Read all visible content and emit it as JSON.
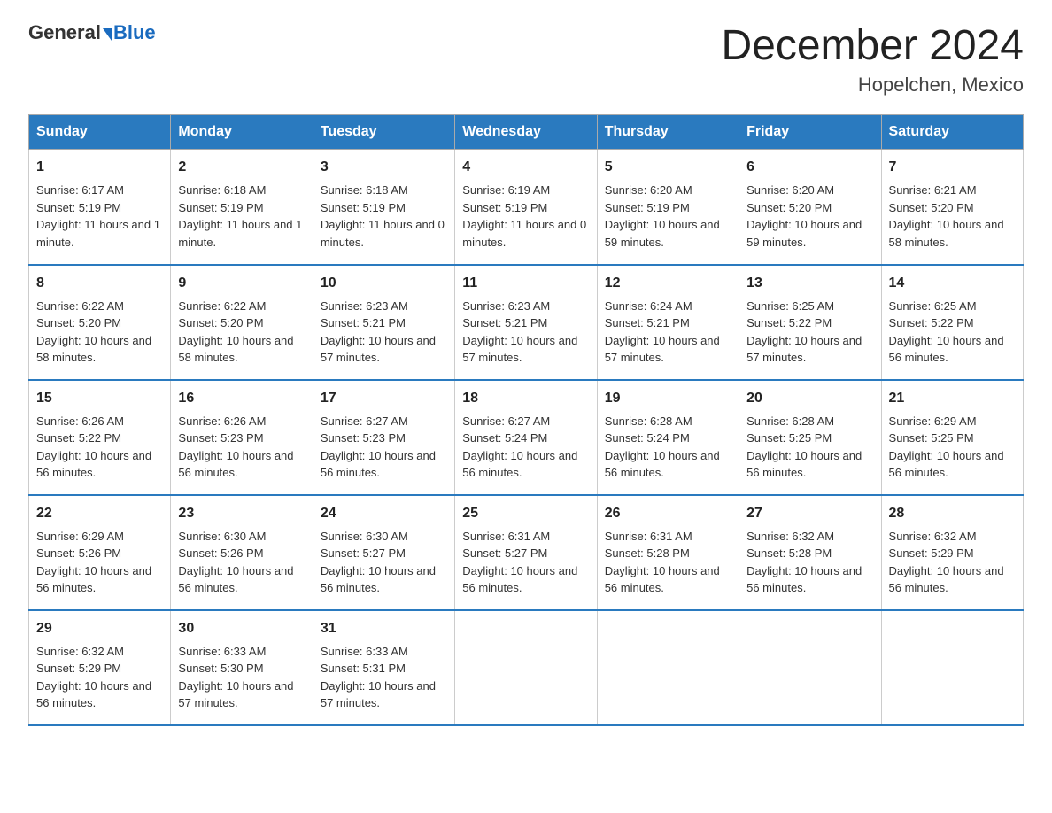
{
  "header": {
    "logo_general": "General",
    "logo_blue": "Blue",
    "main_title": "December 2024",
    "subtitle": "Hopelchen, Mexico"
  },
  "days_of_week": [
    "Sunday",
    "Monday",
    "Tuesday",
    "Wednesday",
    "Thursday",
    "Friday",
    "Saturday"
  ],
  "weeks": [
    [
      {
        "day": 1,
        "sunrise": "6:17 AM",
        "sunset": "5:19 PM",
        "daylight": "11 hours and 1 minute."
      },
      {
        "day": 2,
        "sunrise": "6:18 AM",
        "sunset": "5:19 PM",
        "daylight": "11 hours and 1 minute."
      },
      {
        "day": 3,
        "sunrise": "6:18 AM",
        "sunset": "5:19 PM",
        "daylight": "11 hours and 0 minutes."
      },
      {
        "day": 4,
        "sunrise": "6:19 AM",
        "sunset": "5:19 PM",
        "daylight": "11 hours and 0 minutes."
      },
      {
        "day": 5,
        "sunrise": "6:20 AM",
        "sunset": "5:19 PM",
        "daylight": "10 hours and 59 minutes."
      },
      {
        "day": 6,
        "sunrise": "6:20 AM",
        "sunset": "5:20 PM",
        "daylight": "10 hours and 59 minutes."
      },
      {
        "day": 7,
        "sunrise": "6:21 AM",
        "sunset": "5:20 PM",
        "daylight": "10 hours and 58 minutes."
      }
    ],
    [
      {
        "day": 8,
        "sunrise": "6:22 AM",
        "sunset": "5:20 PM",
        "daylight": "10 hours and 58 minutes."
      },
      {
        "day": 9,
        "sunrise": "6:22 AM",
        "sunset": "5:20 PM",
        "daylight": "10 hours and 58 minutes."
      },
      {
        "day": 10,
        "sunrise": "6:23 AM",
        "sunset": "5:21 PM",
        "daylight": "10 hours and 57 minutes."
      },
      {
        "day": 11,
        "sunrise": "6:23 AM",
        "sunset": "5:21 PM",
        "daylight": "10 hours and 57 minutes."
      },
      {
        "day": 12,
        "sunrise": "6:24 AM",
        "sunset": "5:21 PM",
        "daylight": "10 hours and 57 minutes."
      },
      {
        "day": 13,
        "sunrise": "6:25 AM",
        "sunset": "5:22 PM",
        "daylight": "10 hours and 57 minutes."
      },
      {
        "day": 14,
        "sunrise": "6:25 AM",
        "sunset": "5:22 PM",
        "daylight": "10 hours and 56 minutes."
      }
    ],
    [
      {
        "day": 15,
        "sunrise": "6:26 AM",
        "sunset": "5:22 PM",
        "daylight": "10 hours and 56 minutes."
      },
      {
        "day": 16,
        "sunrise": "6:26 AM",
        "sunset": "5:23 PM",
        "daylight": "10 hours and 56 minutes."
      },
      {
        "day": 17,
        "sunrise": "6:27 AM",
        "sunset": "5:23 PM",
        "daylight": "10 hours and 56 minutes."
      },
      {
        "day": 18,
        "sunrise": "6:27 AM",
        "sunset": "5:24 PM",
        "daylight": "10 hours and 56 minutes."
      },
      {
        "day": 19,
        "sunrise": "6:28 AM",
        "sunset": "5:24 PM",
        "daylight": "10 hours and 56 minutes."
      },
      {
        "day": 20,
        "sunrise": "6:28 AM",
        "sunset": "5:25 PM",
        "daylight": "10 hours and 56 minutes."
      },
      {
        "day": 21,
        "sunrise": "6:29 AM",
        "sunset": "5:25 PM",
        "daylight": "10 hours and 56 minutes."
      }
    ],
    [
      {
        "day": 22,
        "sunrise": "6:29 AM",
        "sunset": "5:26 PM",
        "daylight": "10 hours and 56 minutes."
      },
      {
        "day": 23,
        "sunrise": "6:30 AM",
        "sunset": "5:26 PM",
        "daylight": "10 hours and 56 minutes."
      },
      {
        "day": 24,
        "sunrise": "6:30 AM",
        "sunset": "5:27 PM",
        "daylight": "10 hours and 56 minutes."
      },
      {
        "day": 25,
        "sunrise": "6:31 AM",
        "sunset": "5:27 PM",
        "daylight": "10 hours and 56 minutes."
      },
      {
        "day": 26,
        "sunrise": "6:31 AM",
        "sunset": "5:28 PM",
        "daylight": "10 hours and 56 minutes."
      },
      {
        "day": 27,
        "sunrise": "6:32 AM",
        "sunset": "5:28 PM",
        "daylight": "10 hours and 56 minutes."
      },
      {
        "day": 28,
        "sunrise": "6:32 AM",
        "sunset": "5:29 PM",
        "daylight": "10 hours and 56 minutes."
      }
    ],
    [
      {
        "day": 29,
        "sunrise": "6:32 AM",
        "sunset": "5:29 PM",
        "daylight": "10 hours and 56 minutes."
      },
      {
        "day": 30,
        "sunrise": "6:33 AM",
        "sunset": "5:30 PM",
        "daylight": "10 hours and 57 minutes."
      },
      {
        "day": 31,
        "sunrise": "6:33 AM",
        "sunset": "5:31 PM",
        "daylight": "10 hours and 57 minutes."
      },
      null,
      null,
      null,
      null
    ]
  ]
}
